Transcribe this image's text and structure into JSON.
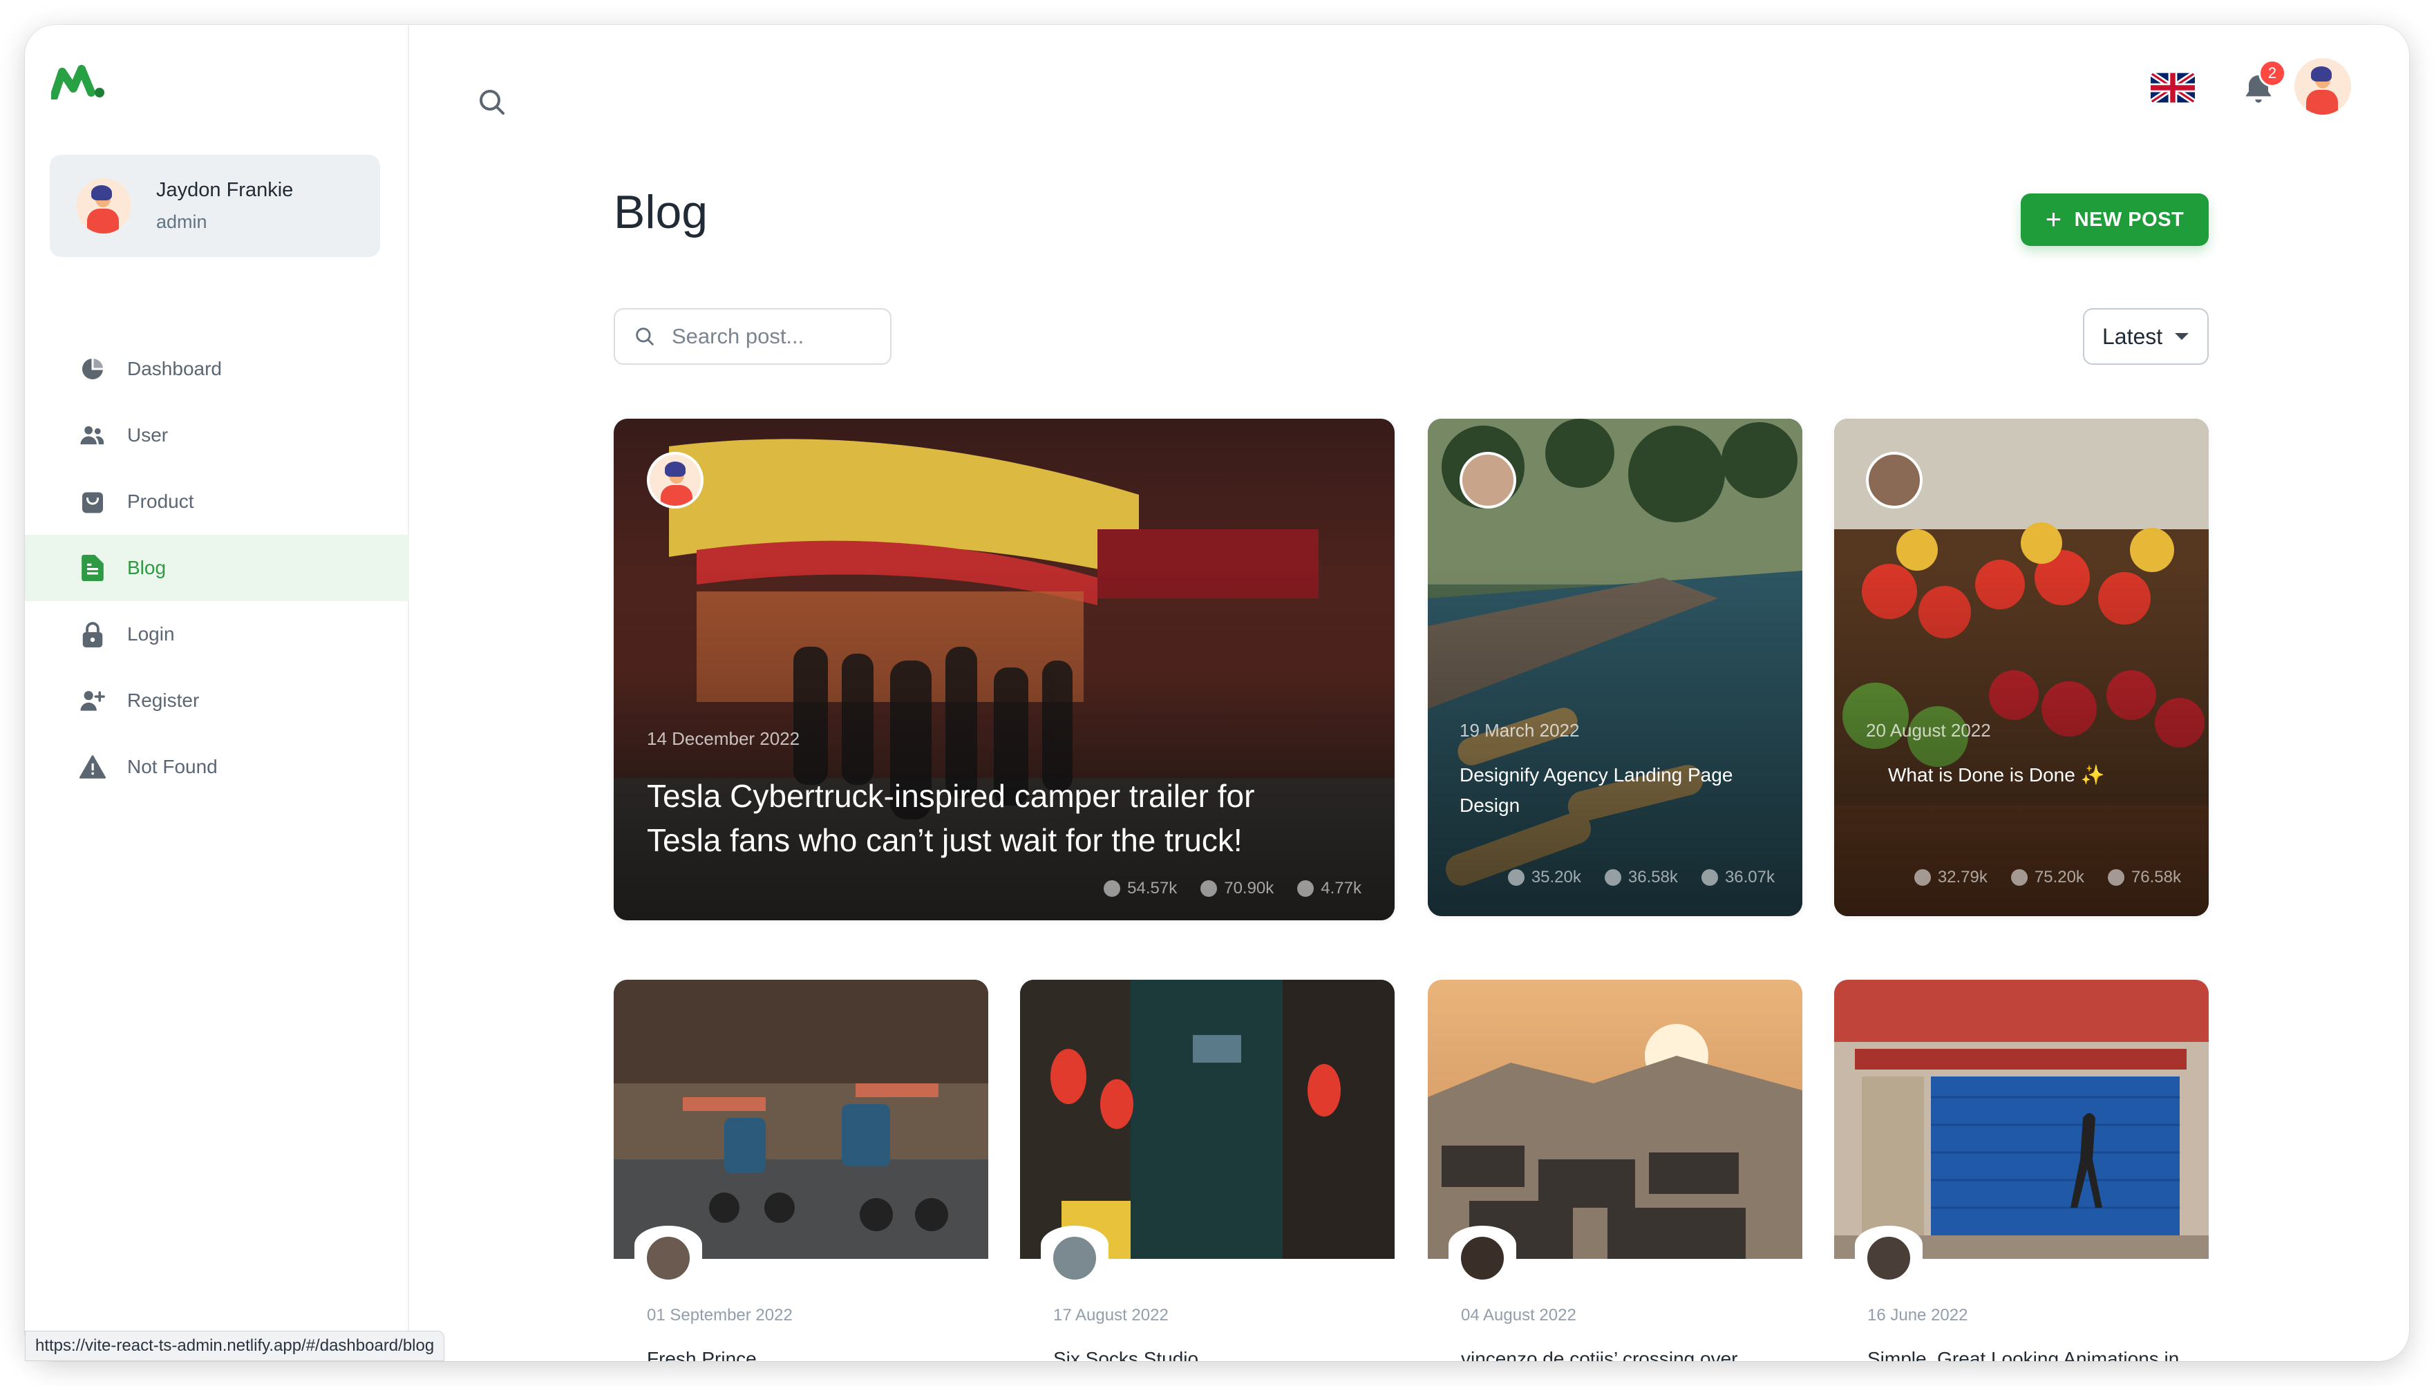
{
  "sidebar": {
    "account": {
      "name": "Jaydon Frankie",
      "role": "admin"
    },
    "items": [
      {
        "label": "Dashboard",
        "icon": "pie-chart-icon"
      },
      {
        "label": "User",
        "icon": "people-icon"
      },
      {
        "label": "Product",
        "icon": "shopping-bag-icon"
      },
      {
        "label": "Blog",
        "icon": "file-text-icon",
        "active": true
      },
      {
        "label": "Login",
        "icon": "lock-icon"
      },
      {
        "label": "Register",
        "icon": "person-add-icon"
      },
      {
        "label": "Not Found",
        "icon": "alert-triangle-icon"
      }
    ]
  },
  "header": {
    "notifications": "2",
    "language_icon": "uk-flag-icon"
  },
  "page": {
    "title": "Blog",
    "new_post_label": "NEW POST",
    "search_placeholder": "Search post...",
    "sort_label": "Latest"
  },
  "posts": [
    {
      "date": "14 December 2022",
      "title": "Tesla Cybertruck-inspired camper trailer for Tesla fans who can’t just wait for the truck!",
      "comments": "54.57k",
      "views": "70.90k",
      "shares": "4.77k"
    },
    {
      "date": "19 March 2022",
      "title": "Designify Agency Landing Page Design",
      "comments": "35.20k",
      "views": "36.58k",
      "shares": "36.07k"
    },
    {
      "date": "20 August 2022",
      "title": "What is Done is Done ✨",
      "comments": "32.79k",
      "views": "75.20k",
      "shares": "76.58k"
    },
    {
      "date": "01 September 2022",
      "title": "Fresh Prince"
    },
    {
      "date": "17 August 2022",
      "title": "Six Socks Studio"
    },
    {
      "date": "04 August 2022",
      "title": "vincenzo de cotiis’ crossing over showcases a research on"
    },
    {
      "date": "16 June 2022",
      "title": "Simple, Great Looking Animations in Your Project | Video Tutorial"
    }
  ],
  "statusbar": {
    "url": "https://vite-react-ts-admin.netlify.app/#/dashboard/blog"
  },
  "colors": {
    "primary": "#1f9d3a",
    "active_bg": "#ebf6ec",
    "badge": "#ff4842"
  }
}
